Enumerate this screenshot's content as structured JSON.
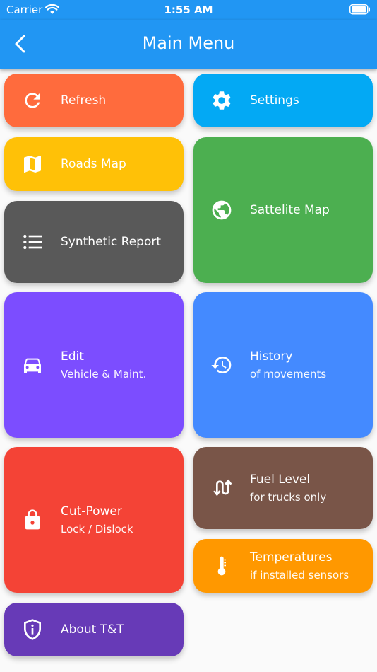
{
  "status_bar": {
    "carrier": "Carrier",
    "time": "1:55 AM"
  },
  "app_bar": {
    "title": "Main Menu"
  },
  "colors": {
    "primary": "#2196f3",
    "refresh": "#ff6b3d",
    "settings": "#03a9f4",
    "roads_map": "#ffc107",
    "satellite_map": "#4caf50",
    "synthetic_report": "#595959",
    "edit": "#7c4dff",
    "history": "#448aff",
    "cut_power": "#f44336",
    "fuel_level": "#795548",
    "temperatures": "#ff9800",
    "about": "#673ab7"
  },
  "menu": {
    "refresh": {
      "label": "Refresh",
      "icon": "refresh-icon"
    },
    "settings": {
      "label": "Settings",
      "icon": "gear-icon"
    },
    "roads_map": {
      "label": "Roads Map",
      "icon": "map-icon"
    },
    "satellite_map": {
      "label": "Sattelite Map",
      "icon": "globe-icon"
    },
    "synthetic_report": {
      "label": "Synthetic Report",
      "icon": "list-icon"
    },
    "edit": {
      "label": "Edit",
      "sub": "Vehicle & Maint.",
      "icon": "car-icon"
    },
    "history": {
      "label": "History",
      "sub": "of movements",
      "icon": "history-icon"
    },
    "cut_power": {
      "label": "Cut-Power",
      "sub": "Lock / Dislock",
      "icon": "lock-icon"
    },
    "fuel_level": {
      "label": "Fuel Level",
      "sub": "for trucks only",
      "icon": "swap-arrows-icon"
    },
    "temperatures": {
      "label": "Temperatures",
      "sub": "if installed sensors",
      "icon": "thermometer-icon"
    },
    "about": {
      "label": "About T&T",
      "icon": "shield-info-icon"
    }
  }
}
